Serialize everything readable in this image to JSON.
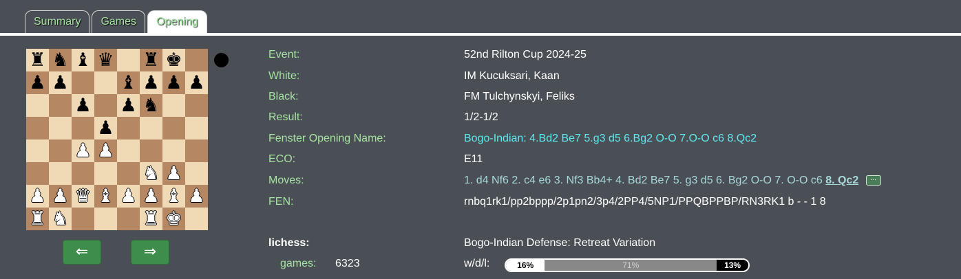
{
  "tabs": [
    {
      "label": "Summary",
      "active": false
    },
    {
      "label": "Games",
      "active": false
    },
    {
      "label": "Opening",
      "active": true
    }
  ],
  "board": {
    "fen_placement": "rnbq1rk1/pp2bppp/2p1pn2/3p4/2PP4/5NP1/PPQBPPBP/RN3RK1",
    "side_to_move": "black",
    "colors": {
      "light": "#f0d9b5",
      "dark": "#b58863"
    }
  },
  "nav": {
    "prev_icon": "⇐",
    "next_icon": "⇒"
  },
  "info": {
    "event_label": "Event:",
    "event": "52nd Rilton Cup 2024-25",
    "white_label": "White:",
    "white": "IM Kucuksari, Kaan",
    "black_label": "Black:",
    "black": "FM Tulchynskyi, Feliks",
    "result_label": "Result:",
    "result": "1/2-1/2",
    "opening_label": "Fenster Opening Name:",
    "opening": "Bogo-Indian: 4.Bd2 Be7 5.g3 d5 6.Bg2 O-O 7.O-O c6 8.Qc2",
    "eco_label": "ECO:",
    "eco": "E11",
    "moves_label": "Moves:",
    "moves": "1. d4 Nf6 2. c4 e6 3. Nf3 Bb4+ 4. Bd2 Be7 5. g3 d5 6. Bg2 O-O 7. O-O c6",
    "last_move": "8. Qc2",
    "more_label": "...",
    "fen_label": "FEN:",
    "fen": "rnbq1rk1/pp2bppp/2p1pn2/3p4/2PP4/5NP1/PPQBPPBP/RN3RK1 b - - 1 8"
  },
  "lichess": {
    "label": "lichess:",
    "opening_name": "Bogo-Indian Defense: Retreat Variation",
    "games_label": "games:",
    "games": "6323",
    "wdl_label": "w/d/l:",
    "white_pct": 16,
    "draw_pct": 71,
    "black_pct": 13,
    "white_text": "16%",
    "draw_text": "71%",
    "black_text": "13%"
  },
  "colors": {
    "accent_green": "#a6e3a1",
    "cyan": "#5fe8ef",
    "background": "#4a4f56",
    "button_green": "#3f8d4d"
  }
}
